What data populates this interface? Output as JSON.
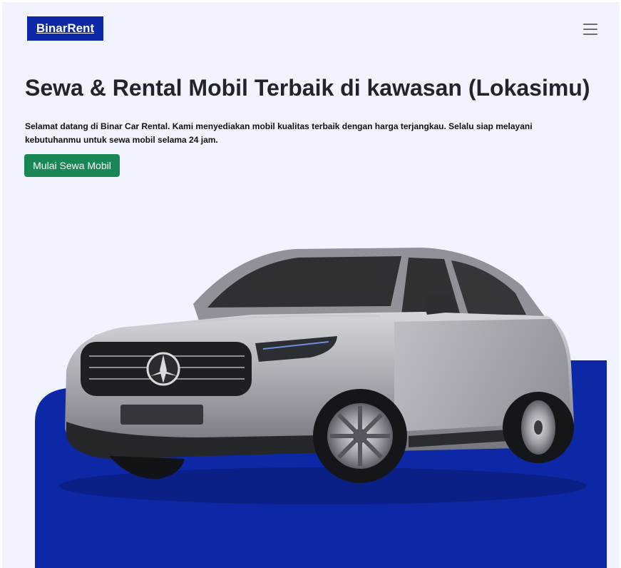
{
  "navbar": {
    "brand": "BinarRent",
    "menu_icon": "hamburger-menu-icon"
  },
  "hero": {
    "title": "Sewa & Rental Mobil Terbaik di kawasan (Lokasimu)",
    "description": "Selamat datang di Binar Car Rental. Kami menyediakan mobil kualitas terbaik dengan harga terjangkau. Selalu siap melayani kebutuhanmu untuk sewa mobil selama 24 jam.",
    "cta_label": "Mulai Sewa Mobil"
  },
  "colors": {
    "brand_blue": "#0d28a6",
    "page_background": "#f1f3fe",
    "cta_green": "#198754",
    "car_silver": "#a9acb2"
  },
  "hero_image": {
    "icon": "car-image",
    "subject": "silver SUV"
  }
}
